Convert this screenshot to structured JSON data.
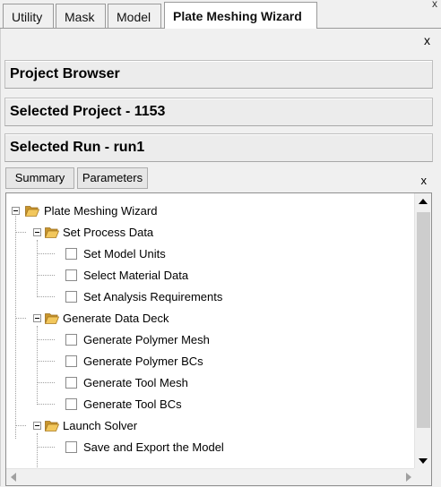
{
  "tabs": [
    {
      "label": "Utility"
    },
    {
      "label": "Mask"
    },
    {
      "label": "Model"
    },
    {
      "label": "Plate Meshing Wizard"
    }
  ],
  "close_label": "x",
  "sections": {
    "project_browser": "Project Browser",
    "selected_project": "Selected Project - 1153",
    "selected_run": "Selected Run - run1"
  },
  "buttons": {
    "summary": "Summary",
    "parameters": "Parameters"
  },
  "tree": {
    "root": "Plate Meshing Wizard",
    "groups": [
      {
        "label": "Set Process Data",
        "items": [
          "Set Model Units",
          "Select Material Data",
          "Set Analysis Requirements"
        ]
      },
      {
        "label": "Generate Data Deck",
        "items": [
          "Generate Polymer Mesh",
          "Generate Polymer BCs",
          "Generate Tool Mesh",
          "Generate Tool BCs"
        ]
      },
      {
        "label": "Launch Solver",
        "items": [
          "Save and Export the Model"
        ]
      }
    ]
  },
  "icons": {
    "folder": "folder-open-icon",
    "expander": "minus-box-icon",
    "checkbox": "unchecked-checkbox"
  },
  "colors": {
    "folder_fill": "#e8b84a",
    "panel_bg": "#f0f0f0"
  }
}
